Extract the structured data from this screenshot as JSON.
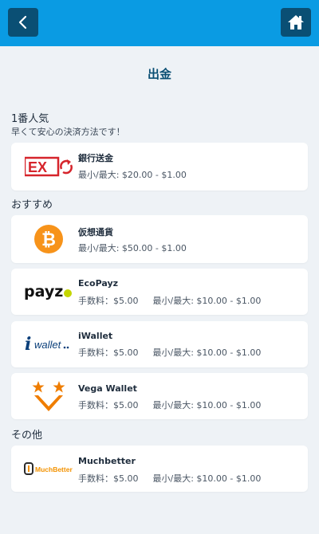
{
  "header": {
    "back_icon": "chevron-left-icon",
    "home_icon": "home-icon",
    "accent_color": "#0a9be3",
    "button_color": "#0a4f74"
  },
  "page": {
    "title": "出金"
  },
  "sections": {
    "popular": {
      "title": "1番人気",
      "subtitle": "早くて安心の決済方法です！"
    },
    "recommended": {
      "title": "おすすめ"
    },
    "other": {
      "title": "その他"
    }
  },
  "methods": {
    "bank": {
      "name": "銀行送金",
      "limit": "最小/最大: $20.00 - $1.00",
      "logo_text": "EX"
    },
    "crypto": {
      "name": "仮想通貨",
      "limit": "最小/最大: $50.00 - $1.00"
    },
    "ecopayz": {
      "name": "EcoPayz",
      "fee": "手数料：$5.00",
      "limit": "最小/最大: $10.00 - $1.00",
      "logo_text": "payz"
    },
    "iwallet": {
      "name": "iWallet",
      "fee": "手数料：$5.00",
      "limit": "最小/最大: $10.00 - $1.00",
      "logo_text": "wallet"
    },
    "vega": {
      "name": "Vega Wallet",
      "fee": "手数料：$5.00",
      "limit": "最小/最大: $10.00 - $1.00"
    },
    "muchbetter": {
      "name": "Muchbetter",
      "fee": "手数料：$5.00",
      "limit": "最小/最大: $10.00 - $1.00",
      "logo_text": "MuchBetter"
    }
  }
}
